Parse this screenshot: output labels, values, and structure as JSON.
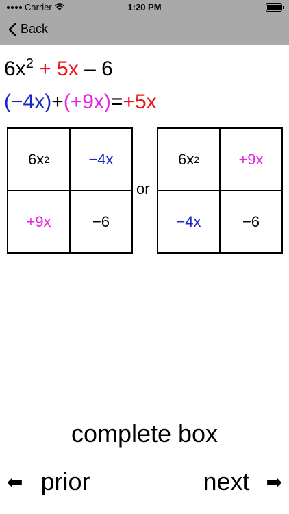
{
  "status": {
    "carrier": "Carrier",
    "time": "1:20 PM"
  },
  "nav": {
    "back_label": "Back"
  },
  "expression": {
    "term1_coef": "6x",
    "term1_exp": "2",
    "term2_sign": "+",
    "term2": "5x",
    "term3": "– 6"
  },
  "sum_equation": {
    "part1": "(−4x)",
    "plus": "+",
    "part2": "(+9x)",
    "equals": "=",
    "result": "+5x"
  },
  "box1": {
    "top_left_base": "6x",
    "top_left_exp": "2",
    "top_right": "−4x",
    "bottom_left": "+9x",
    "bottom_right": "−6"
  },
  "or_label": "or",
  "box2": {
    "top_left_base": "6x",
    "top_left_exp": "2",
    "top_right": "+9x",
    "bottom_left": "−4x",
    "bottom_right": "−6"
  },
  "complete_label": "complete box",
  "prior_label": "prior",
  "next_label": "next",
  "colors": {
    "red": "#e8141b",
    "blue": "#1a28c8",
    "magenta": "#e324e3",
    "nav_background": "#a9a9a9"
  }
}
